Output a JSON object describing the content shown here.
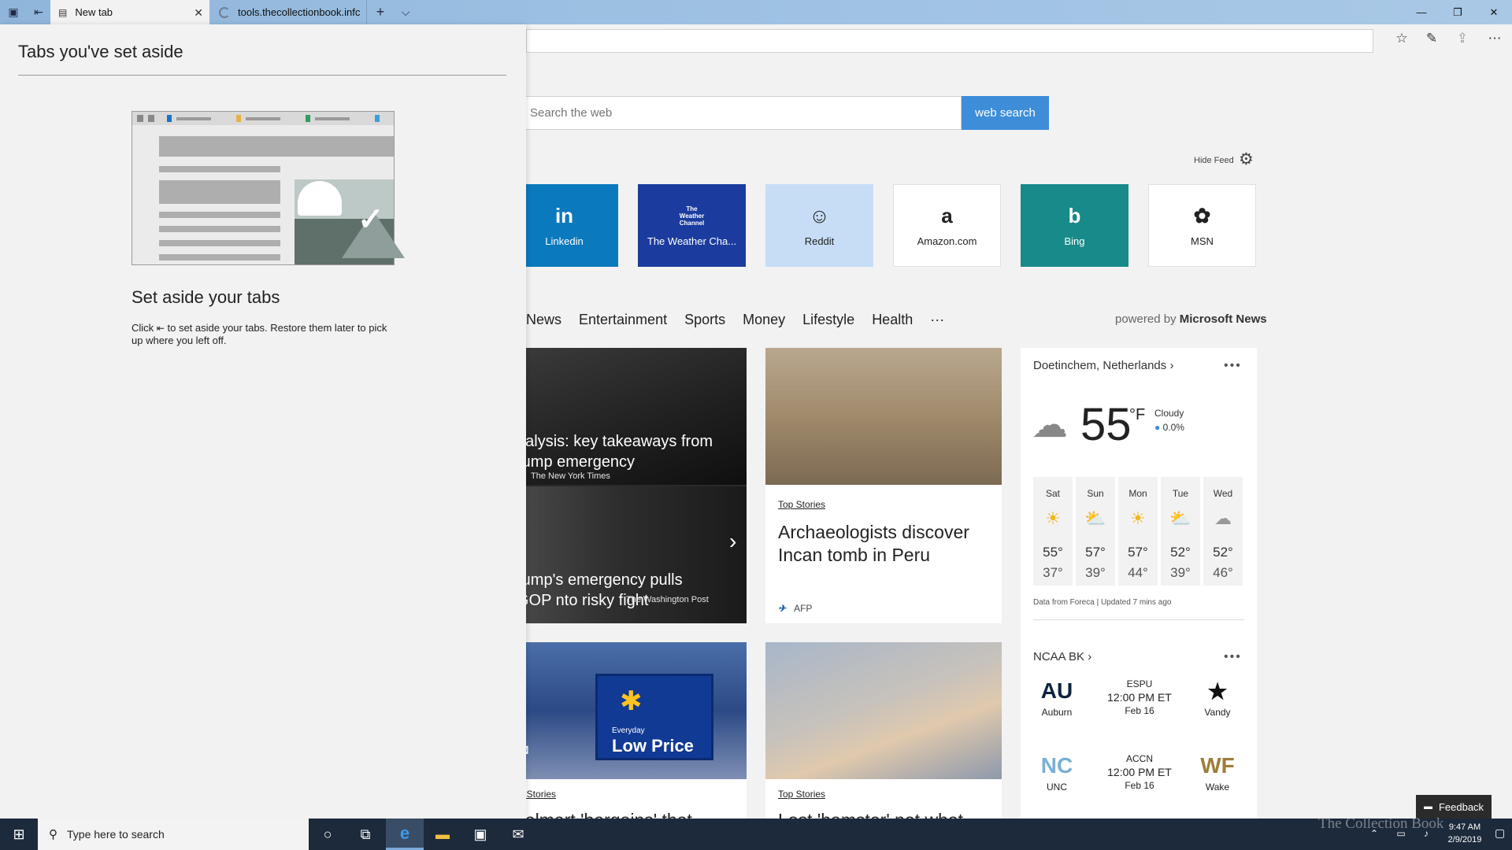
{
  "browser": {
    "tabs": [
      {
        "title": "New tab"
      },
      {
        "title": "tools.thecollectionbook.infc"
      }
    ],
    "new_tab_symbol": "+",
    "tab_list_symbol": "⌵",
    "tab_close_symbol": "✕",
    "window": {
      "minimize": "—",
      "restore": "❐",
      "close": "✕"
    }
  },
  "aside_panel": {
    "heading": "Tabs you've set aside",
    "subheading": "Set aside your tabs",
    "instruction_before": "Click",
    "instruction_after": "to set aside your tabs. Restore them later to pick up where you left off."
  },
  "search": {
    "placeholder": "Search the web",
    "button_label": "web search"
  },
  "feed": {
    "hide_label": "Hide Feed"
  },
  "tiles": [
    {
      "label": "Linkedin",
      "glyph": "in"
    },
    {
      "label": "The Weather Cha...",
      "glyph": "The Weather Channel"
    },
    {
      "label": "Reddit",
      "glyph": "☺"
    },
    {
      "label": "Amazon.com",
      "glyph": "a"
    },
    {
      "label": "Bing",
      "glyph": "b"
    },
    {
      "label": "MSN",
      "glyph": "✿"
    }
  ],
  "categories": [
    "News",
    "Entertainment",
    "Sports",
    "Money",
    "Lifestyle",
    "Health",
    "···"
  ],
  "powered_by": {
    "prefix": "powered by",
    "brand": "Microsoft News"
  },
  "stories": {
    "hero": [
      {
        "headline": "nalysis: key takeaways from rump emergency",
        "source": "The New York Times"
      },
      {
        "headline": "rump's emergency pulls GOP nto risky fight",
        "source": "The Washington Post"
      }
    ],
    "hero_dots": "••••••••••",
    "archaeology": {
      "tag": "Top Stories",
      "headline": "Archaeologists discover Incan tomb in Peru",
      "source": "AFP"
    },
    "walmart": {
      "tag": "Top Stories",
      "headline": "Walmart 'bargains' that",
      "sign_small": "Everyday",
      "sign_big": "Low Price"
    },
    "hamster": {
      "tag": "Top Stories",
      "headline": "Lost 'hamster' not what"
    }
  },
  "weather": {
    "location": "Doetinchem, Netherlands",
    "temperature": "55",
    "unit": "°F",
    "condition": "Cloudy",
    "precipitation": "0.0%",
    "forecast": [
      {
        "day": "Sat",
        "hi": "55°",
        "lo": "37°",
        "icon": "sun"
      },
      {
        "day": "Sun",
        "hi": "57°",
        "lo": "39°",
        "icon": "partly-cloudy"
      },
      {
        "day": "Mon",
        "hi": "57°",
        "lo": "44°",
        "icon": "sun"
      },
      {
        "day": "Tue",
        "hi": "52°",
        "lo": "39°",
        "icon": "partly-cloudy"
      },
      {
        "day": "Wed",
        "hi": "52°",
        "lo": "46°",
        "icon": "cloud"
      }
    ],
    "source": "Data from Foreca | Updated 7 mins ago"
  },
  "ncaa": {
    "title": "NCAA BK",
    "games": [
      {
        "home": "Auburn",
        "away": "Vandy",
        "network": "ESPU",
        "time": "12:00 PM ET",
        "date": "Feb 16"
      },
      {
        "home": "UNC",
        "away": "Wake",
        "network": "ACCN",
        "time": "12:00 PM ET",
        "date": "Feb 16"
      }
    ]
  },
  "feedback_label": "Feedback",
  "taskbar": {
    "search_placeholder": "Type here to search",
    "time": "9:47 AM",
    "date": "2/9/2019"
  },
  "watermark": "The Collection Book",
  "colors": {
    "accent": "#3d8dd9",
    "titlebar": "#9cc0e2",
    "taskbar": "#1d2a3c"
  }
}
